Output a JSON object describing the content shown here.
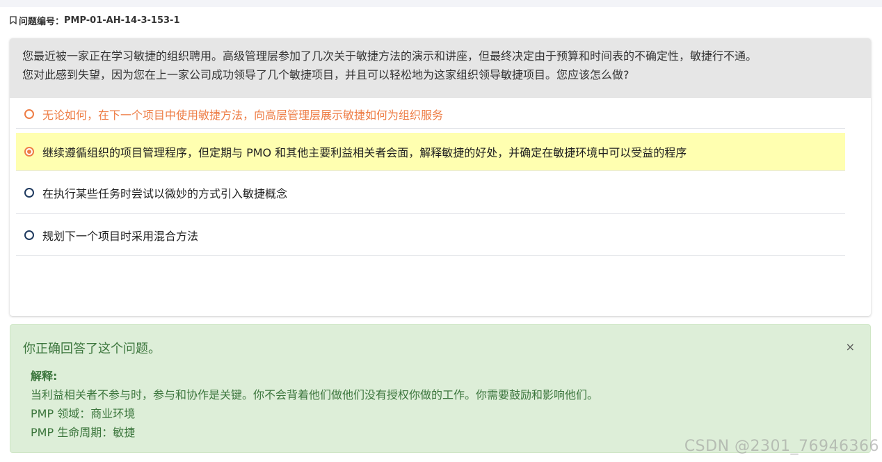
{
  "question_id": {
    "label": "问题编号：",
    "value": "PMP-01-AH-14-3-153-1",
    "icon": "bookmark-icon"
  },
  "question": {
    "text_line1": "您最近被一家正在学习敏捷的组织聘用。高级管理层参加了几次关于敏捷方法的演示和讲座，但最终决定由于预算和时间表的不确定性，敏捷行不通。",
    "text_line2": "您对此感到失望，因为您在上一家公司成功领导了几个敏捷项目，并且可以轻松地为这家组织领导敏捷项目。您应该怎么做?"
  },
  "options": [
    {
      "text": "无论如何，在下一个项目中使用敏捷方法，向高层管理层展示敏捷如何为组织服务",
      "selected": false,
      "color": "#ee7d45"
    },
    {
      "text": "继续遵循组织的项目管理程序，但定期与 PMO 和其他主要利益相关者会面，解释敏捷的好处，并确定在敏捷环境中可以受益的程序",
      "selected": true,
      "highlight": "#ffffb0"
    },
    {
      "text": "在执行某些任务时尝试以微妙的方式引入敏捷概念",
      "selected": false
    },
    {
      "text": "规划下一个项目时采用混合方法",
      "selected": false
    }
  ],
  "result": {
    "title": "你正确回答了这个问题。",
    "close_label": "×",
    "explanation_label": "解释:",
    "explanation_text": "当利益相关者不参与时，参与和协作是关键。你不会背着他们做他们没有授权你做的工作。你需要鼓励和影响他们。",
    "domain": "PMP 领域：商业环境",
    "lifecycle": "PMP 生命周期：敏捷",
    "color": "#3c763d",
    "background": "#ddeed8"
  },
  "watermark": "CSDN @2301_76946366"
}
